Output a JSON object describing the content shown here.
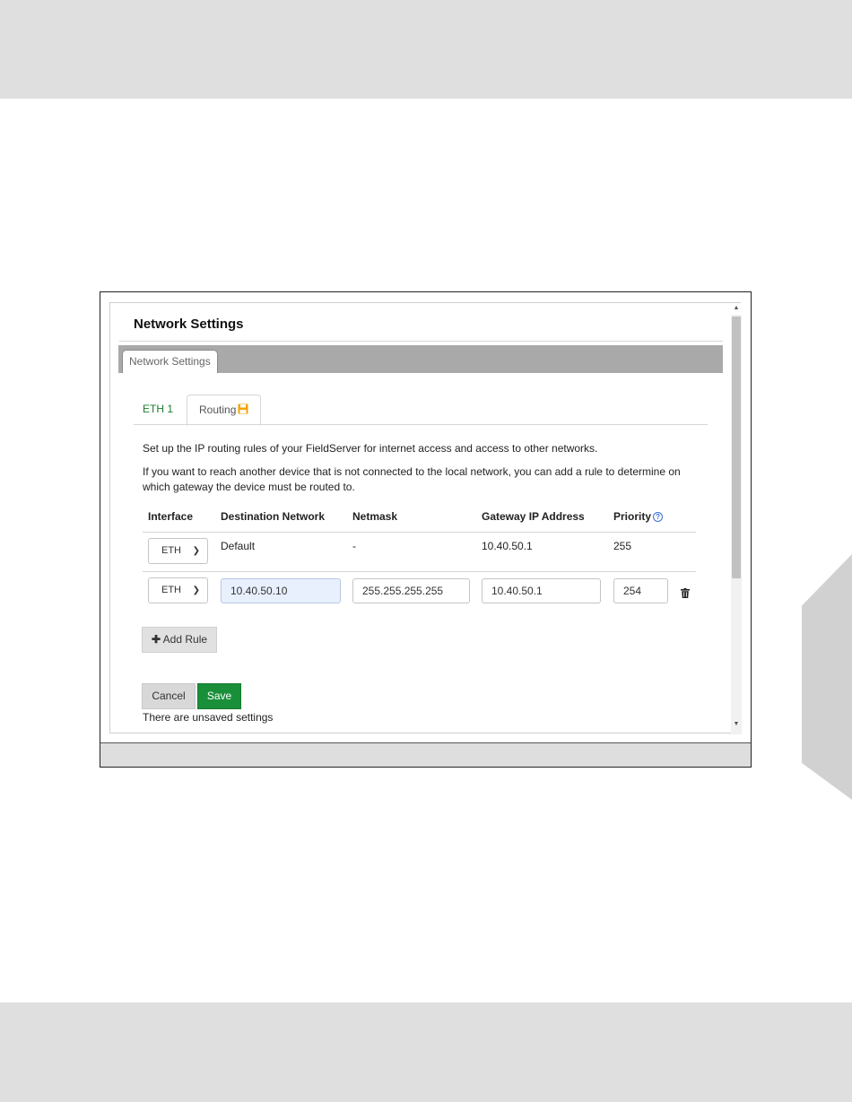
{
  "window": {
    "title": "Network Settings",
    "outer_tab": "Network Settings"
  },
  "tabs": {
    "eth1": "ETH 1",
    "routing": "Routing",
    "routing_icon": "save-icon",
    "active": "Routing"
  },
  "description": {
    "line1": "Set up the IP routing rules of your FieldServer for internet access and access to other networks.",
    "line2": "If you want to reach another device that is not connected to the local network, you can add a rule to determine on which gateway the device must be routed to."
  },
  "table": {
    "headers": {
      "interface": "Interface",
      "destination": "Destination Network",
      "netmask": "Netmask",
      "gateway": "Gateway IP Address",
      "priority": "Priority"
    },
    "default_row": {
      "interface": "ETH",
      "destination": "Default",
      "netmask": "-",
      "gateway": "10.40.50.1",
      "priority": "255"
    },
    "rule_row": {
      "interface": "ETH",
      "destination": "10.40.50.10",
      "netmask": "255.255.255.255",
      "gateway": "10.40.50.1",
      "priority": "254"
    }
  },
  "buttons": {
    "add_rule": "Add Rule",
    "cancel": "Cancel",
    "save": "Save"
  },
  "status": {
    "unsaved": "There are unsaved settings"
  },
  "colors": {
    "accent_green": "#1a8f3a",
    "tab_green": "#1e7b2f",
    "save_icon_orange": "#f0a500",
    "help_blue": "#3a6fd8"
  }
}
